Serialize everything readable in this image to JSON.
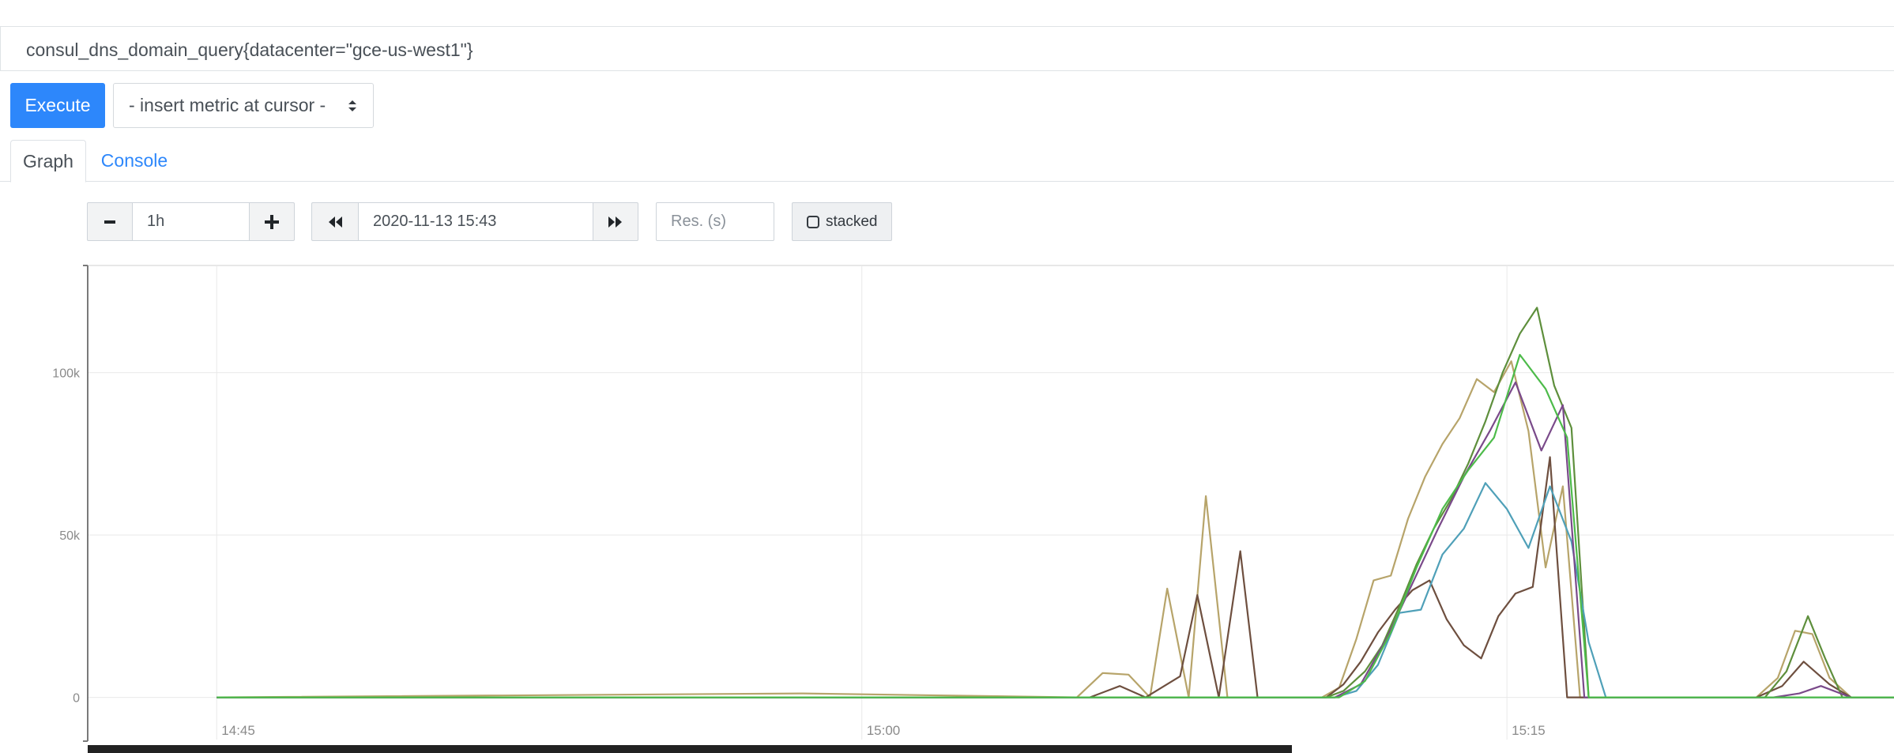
{
  "query": {
    "value": "consul_dns_domain_query{datacenter=\"gce-us-west1\"}"
  },
  "toolbar": {
    "execute_label": "Execute",
    "metric_select_value": "- insert metric at cursor -"
  },
  "tabs": [
    {
      "label": "Graph",
      "active": true
    },
    {
      "label": "Console",
      "active": false
    }
  ],
  "graph_controls": {
    "range_decrease_icon": "minus-icon",
    "range_value": "1h",
    "range_increase_icon": "plus-icon",
    "time_back_icon": "double-chevron-left-icon",
    "end_time_value": "2020-11-13 15:43",
    "time_forward_icon": "double-chevron-right-icon",
    "resolution_placeholder": "Res. (s)",
    "stacked_label": "stacked",
    "stacked_checked": false
  },
  "colors": {
    "accent": "#2d87fb",
    "series": [
      "#b7a46a",
      "#6e4f3f",
      "#5e8f3c",
      "#4fa0b8",
      "#7a4a8a",
      "#4dbb4a",
      "#a89a5e",
      "#8a6d4c",
      "#3f6fb5",
      "#6b3b3b",
      "#d7a84b",
      "#c7b56f"
    ]
  },
  "chart_data": {
    "type": "line",
    "title": "",
    "xlabel": "",
    "ylabel": "",
    "x_ticks": [
      "14:45",
      "15:00",
      "15:15"
    ],
    "y_ticks": [
      "0",
      "50k",
      "100k"
    ],
    "x_range_minutes": [
      -3,
      39
    ],
    "ylim": [
      -13000,
      133000
    ],
    "grid": true,
    "legend": "none",
    "notes_x_unit": "minutes after 14:45",
    "series": [
      {
        "x": [
          0,
          13.6,
          20.0,
          20.6,
          21.2,
          21.7,
          22.1,
          22.6,
          23.0,
          23.5,
          24.0,
          25.7,
          26.1,
          26.5,
          26.9,
          27.3,
          27.7,
          28.1,
          28.5,
          28.9,
          29.3,
          29.7,
          30.1,
          30.5,
          30.9,
          31.3,
          31.7,
          32.1,
          34.5,
          35.8,
          36.3,
          36.7,
          37.1,
          37.5,
          38.0,
          39.0
        ],
        "y": [
          0,
          1200,
          0,
          7500,
          7000,
          0,
          33500,
          0,
          62000,
          0,
          0,
          0,
          3000,
          18000,
          36000,
          37500,
          55000,
          68000,
          78000,
          86000,
          98000,
          94000,
          103500,
          82000,
          40000,
          65000,
          0,
          0,
          0,
          0,
          6000,
          20500,
          19500,
          6000,
          0,
          0
        ]
      },
      {
        "x": [
          0,
          20.3,
          21.0,
          21.6,
          22.4,
          22.8,
          23.3,
          23.8,
          24.2,
          25.8,
          26.2,
          26.6,
          27.0,
          27.4,
          27.8,
          28.2,
          28.6,
          29.0,
          29.4,
          29.8,
          30.2,
          30.6,
          31.0,
          31.4,
          31.8,
          32.1,
          35.8,
          36.4,
          36.9,
          37.5,
          38.0,
          39.0
        ],
        "y": [
          0,
          0,
          3500,
          0,
          6500,
          31500,
          0,
          45000,
          0,
          0,
          4000,
          11000,
          20000,
          27000,
          33000,
          36000,
          24000,
          16000,
          12000,
          25000,
          32000,
          34000,
          74000,
          0,
          0,
          0,
          0,
          3500,
          11000,
          4000,
          0,
          0
        ]
      },
      {
        "x": [
          0,
          25.8,
          26.2,
          26.7,
          27.1,
          27.5,
          27.9,
          28.3,
          28.7,
          29.1,
          29.5,
          29.9,
          30.3,
          30.7,
          31.1,
          31.5,
          31.9,
          32.2,
          36.0,
          36.5,
          37.0,
          37.4,
          37.8,
          39.0
        ],
        "y": [
          0,
          0,
          2000,
          8000,
          16000,
          28000,
          41000,
          52000,
          61000,
          72000,
          85000,
          100000,
          112000,
          120000,
          96000,
          83000,
          0,
          0,
          0,
          8000,
          25000,
          12000,
          0,
          0
        ]
      },
      {
        "x": [
          0,
          26.0,
          26.5,
          27.0,
          27.5,
          28.0,
          28.5,
          29.0,
          29.5,
          30.0,
          30.5,
          31.0,
          31.5,
          31.9,
          32.3,
          39.0
        ],
        "y": [
          0,
          0,
          2000,
          10000,
          26000,
          27000,
          44000,
          52000,
          66000,
          58000,
          46000,
          65000,
          48000,
          17000,
          0,
          0
        ]
      },
      {
        "x": [
          0,
          26.0,
          26.6,
          27.2,
          27.8,
          28.4,
          29.0,
          29.6,
          30.2,
          30.8,
          31.3,
          31.8,
          32.1,
          36.2,
          36.8,
          37.3,
          38.0,
          39.0
        ],
        "y": [
          0,
          0,
          4000,
          18000,
          35000,
          52000,
          68000,
          82000,
          97000,
          76000,
          90000,
          0,
          0,
          0,
          1200,
          3500,
          0,
          0
        ]
      },
      {
        "x": [
          0,
          26.1,
          26.7,
          27.3,
          27.9,
          28.5,
          29.1,
          29.7,
          30.3,
          30.9,
          31.4,
          31.9,
          32.2,
          39.0
        ],
        "y": [
          0,
          0,
          5000,
          20000,
          40000,
          58000,
          70000,
          80000,
          105500,
          95000,
          80000,
          0,
          0,
          0
        ]
      }
    ]
  }
}
